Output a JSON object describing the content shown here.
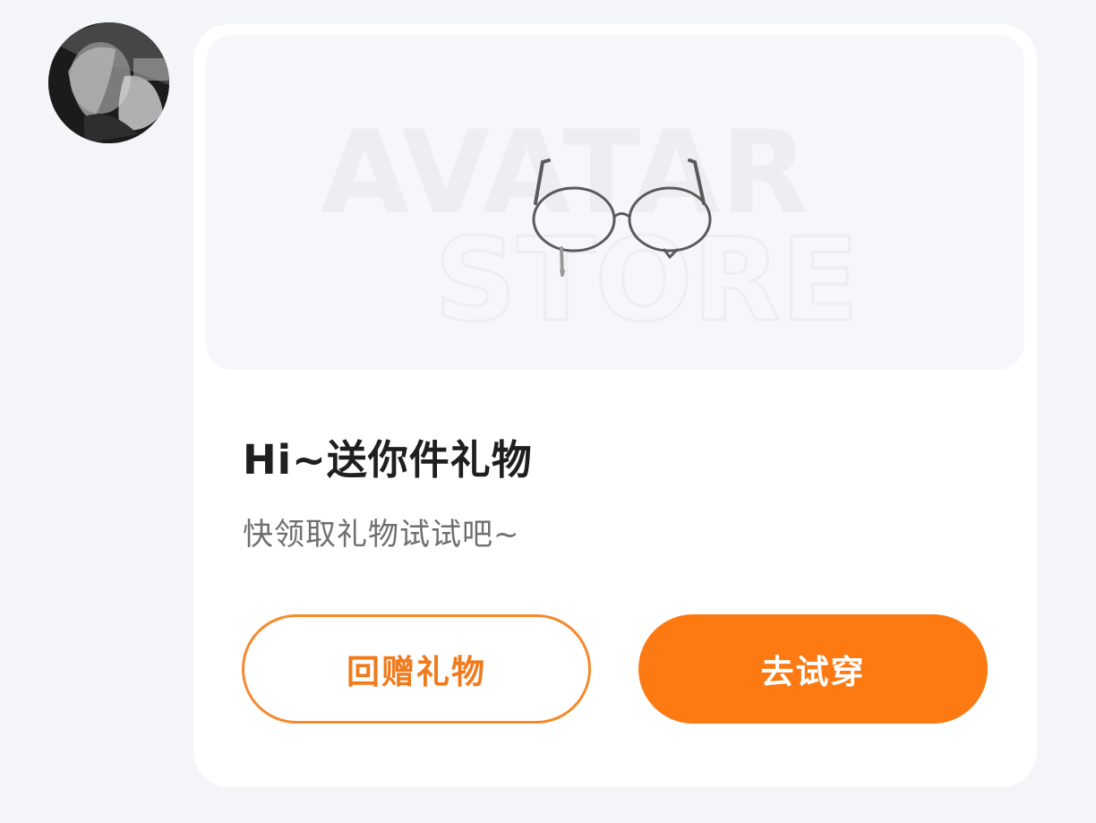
{
  "avatar": {
    "icon": "user-avatar-photo"
  },
  "gift_card": {
    "banner": {
      "watermark_line1": "AVATAR",
      "watermark_line2": "STORE",
      "item_icon": "glasses-icon"
    },
    "title": "Hi~送你件礼物",
    "subtitle": "快领取礼物试试吧~",
    "buttons": {
      "return_gift": "回赠礼物",
      "try_on": "去试穿"
    }
  },
  "colors": {
    "accent": "#fd7a12",
    "outline_text": "#f07b1d",
    "background": "#f4f5f9",
    "card": "#ffffff"
  }
}
